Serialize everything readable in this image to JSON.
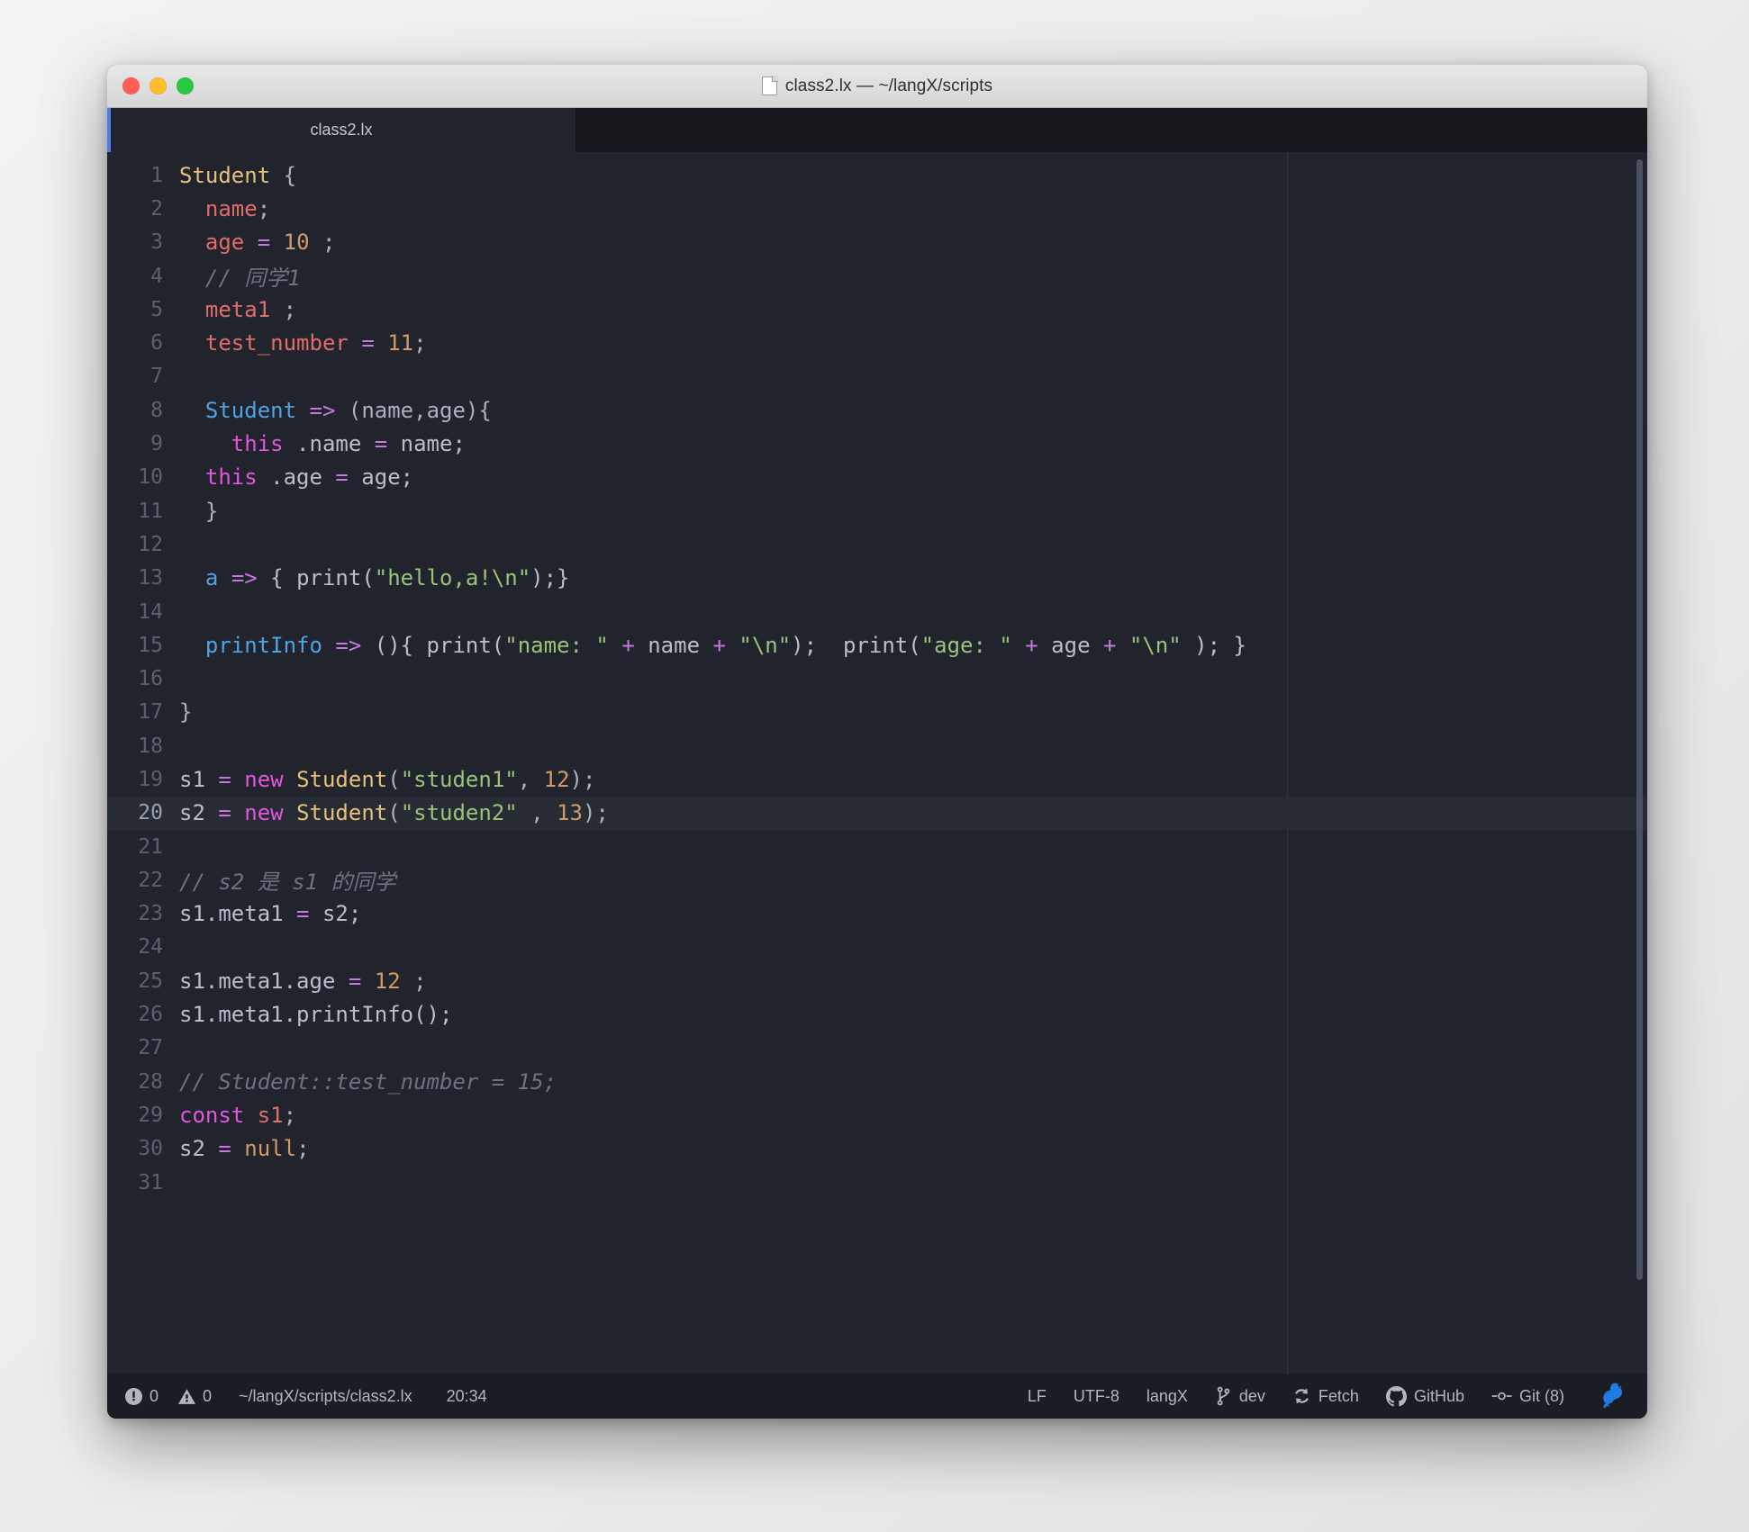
{
  "window": {
    "title": "class2.lx — ~/langX/scripts",
    "title_icon": "document-icon",
    "controls": {
      "close": "close",
      "minimize": "minimize",
      "zoom": "zoom"
    }
  },
  "tabs": [
    {
      "label": "class2.lx",
      "active": true
    }
  ],
  "editor": {
    "active_line": 20,
    "lines": [
      {
        "n": "1",
        "tokens": [
          {
            "t": "Student",
            "c": "t-class"
          },
          {
            "t": " {",
            "c": "t-punc"
          }
        ]
      },
      {
        "n": "2",
        "tokens": [
          {
            "t": "  ",
            "c": "t-plain"
          },
          {
            "t": "name",
            "c": "t-prop"
          },
          {
            "t": ";",
            "c": "t-punc"
          }
        ]
      },
      {
        "n": "3",
        "tokens": [
          {
            "t": "  ",
            "c": "t-plain"
          },
          {
            "t": "age",
            "c": "t-prop"
          },
          {
            "t": " ",
            "c": "t-plain"
          },
          {
            "t": "=",
            "c": "t-op"
          },
          {
            "t": " ",
            "c": "t-plain"
          },
          {
            "t": "10",
            "c": "t-num"
          },
          {
            "t": " ;",
            "c": "t-punc"
          }
        ]
      },
      {
        "n": "4",
        "tokens": [
          {
            "t": "  // 同学1",
            "c": "t-comment"
          }
        ]
      },
      {
        "n": "5",
        "tokens": [
          {
            "t": "  ",
            "c": "t-plain"
          },
          {
            "t": "meta1",
            "c": "t-prop"
          },
          {
            "t": " ;",
            "c": "t-punc"
          }
        ]
      },
      {
        "n": "6",
        "tokens": [
          {
            "t": "  ",
            "c": "t-plain"
          },
          {
            "t": "test_number",
            "c": "t-prop"
          },
          {
            "t": " ",
            "c": "t-plain"
          },
          {
            "t": "=",
            "c": "t-op"
          },
          {
            "t": " ",
            "c": "t-plain"
          },
          {
            "t": "11",
            "c": "t-num"
          },
          {
            "t": ";",
            "c": "t-punc"
          }
        ]
      },
      {
        "n": "7",
        "tokens": []
      },
      {
        "n": "8",
        "tokens": [
          {
            "t": "  ",
            "c": "t-plain"
          },
          {
            "t": "Student",
            "c": "t-fn"
          },
          {
            "t": " ",
            "c": "t-plain"
          },
          {
            "t": "=>",
            "c": "t-op"
          },
          {
            "t": " (name,age){",
            "c": "t-punc"
          }
        ]
      },
      {
        "n": "9",
        "tokens": [
          {
            "t": "    ",
            "c": "t-plain"
          },
          {
            "t": "this",
            "c": "t-kw"
          },
          {
            "t": " .name ",
            "c": "t-plain"
          },
          {
            "t": "=",
            "c": "t-op"
          },
          {
            "t": " name;",
            "c": "t-plain"
          }
        ]
      },
      {
        "n": "10",
        "tokens": [
          {
            "t": "  ",
            "c": "t-plain"
          },
          {
            "t": "this",
            "c": "t-kw"
          },
          {
            "t": " .age ",
            "c": "t-plain"
          },
          {
            "t": "=",
            "c": "t-op"
          },
          {
            "t": " age;",
            "c": "t-plain"
          }
        ]
      },
      {
        "n": "11",
        "tokens": [
          {
            "t": "  }",
            "c": "t-punc"
          }
        ]
      },
      {
        "n": "12",
        "tokens": []
      },
      {
        "n": "13",
        "tokens": [
          {
            "t": "  ",
            "c": "t-plain"
          },
          {
            "t": "a",
            "c": "t-fn"
          },
          {
            "t": " ",
            "c": "t-plain"
          },
          {
            "t": "=>",
            "c": "t-op"
          },
          {
            "t": " { print(",
            "c": "t-plain"
          },
          {
            "t": "\"hello,a!\\n\"",
            "c": "t-str"
          },
          {
            "t": ");}",
            "c": "t-plain"
          }
        ]
      },
      {
        "n": "14",
        "tokens": []
      },
      {
        "n": "15",
        "tokens": [
          {
            "t": "  ",
            "c": "t-plain"
          },
          {
            "t": "printInfo",
            "c": "t-fn"
          },
          {
            "t": " ",
            "c": "t-plain"
          },
          {
            "t": "=>",
            "c": "t-op"
          },
          {
            "t": " (){ print(",
            "c": "t-plain"
          },
          {
            "t": "\"name: \"",
            "c": "t-str"
          },
          {
            "t": " ",
            "c": "t-plain"
          },
          {
            "t": "+",
            "c": "t-op"
          },
          {
            "t": " name ",
            "c": "t-plain"
          },
          {
            "t": "+",
            "c": "t-op"
          },
          {
            "t": " ",
            "c": "t-plain"
          },
          {
            "t": "\"\\n\"",
            "c": "t-str"
          },
          {
            "t": ");  print(",
            "c": "t-plain"
          },
          {
            "t": "\"age: \"",
            "c": "t-str"
          },
          {
            "t": " ",
            "c": "t-plain"
          },
          {
            "t": "+",
            "c": "t-op"
          },
          {
            "t": " age ",
            "c": "t-plain"
          },
          {
            "t": "+",
            "c": "t-op"
          },
          {
            "t": " ",
            "c": "t-plain"
          },
          {
            "t": "\"\\n\"",
            "c": "t-str"
          },
          {
            "t": " ); }",
            "c": "t-plain"
          }
        ]
      },
      {
        "n": "16",
        "tokens": []
      },
      {
        "n": "17",
        "tokens": [
          {
            "t": "}",
            "c": "t-punc"
          }
        ]
      },
      {
        "n": "18",
        "tokens": []
      },
      {
        "n": "19",
        "tokens": [
          {
            "t": "s1 ",
            "c": "t-plain"
          },
          {
            "t": "=",
            "c": "t-op"
          },
          {
            "t": " ",
            "c": "t-plain"
          },
          {
            "t": "new",
            "c": "t-kw"
          },
          {
            "t": " ",
            "c": "t-plain"
          },
          {
            "t": "Student",
            "c": "t-class"
          },
          {
            "t": "(",
            "c": "t-punc"
          },
          {
            "t": "\"studen1\"",
            "c": "t-str"
          },
          {
            "t": ", ",
            "c": "t-punc"
          },
          {
            "t": "12",
            "c": "t-num"
          },
          {
            "t": ");",
            "c": "t-punc"
          }
        ]
      },
      {
        "n": "20",
        "tokens": [
          {
            "t": "s2 ",
            "c": "t-plain"
          },
          {
            "t": "=",
            "c": "t-op"
          },
          {
            "t": " ",
            "c": "t-plain"
          },
          {
            "t": "new",
            "c": "t-kw"
          },
          {
            "t": " ",
            "c": "t-plain"
          },
          {
            "t": "Student",
            "c": "t-class"
          },
          {
            "t": "(",
            "c": "t-punc"
          },
          {
            "t": "\"studen2\"",
            "c": "t-str"
          },
          {
            "t": " , ",
            "c": "t-punc"
          },
          {
            "t": "13",
            "c": "t-num"
          },
          {
            "t": ");",
            "c": "t-punc"
          }
        ]
      },
      {
        "n": "21",
        "tokens": []
      },
      {
        "n": "22",
        "tokens": [
          {
            "t": "// s2 是 s1 的同学",
            "c": "t-comment"
          }
        ]
      },
      {
        "n": "23",
        "tokens": [
          {
            "t": "s1.meta1 ",
            "c": "t-plain"
          },
          {
            "t": "=",
            "c": "t-op"
          },
          {
            "t": " s2;",
            "c": "t-plain"
          }
        ]
      },
      {
        "n": "24",
        "tokens": []
      },
      {
        "n": "25",
        "tokens": [
          {
            "t": "s1.meta1.age ",
            "c": "t-plain"
          },
          {
            "t": "=",
            "c": "t-op"
          },
          {
            "t": " ",
            "c": "t-plain"
          },
          {
            "t": "12",
            "c": "t-num"
          },
          {
            "t": " ;",
            "c": "t-punc"
          }
        ]
      },
      {
        "n": "26",
        "tokens": [
          {
            "t": "s1.meta1.printInfo();",
            "c": "t-plain"
          }
        ]
      },
      {
        "n": "27",
        "tokens": []
      },
      {
        "n": "28",
        "tokens": [
          {
            "t": "// Student::test_number = 15;",
            "c": "t-comment"
          }
        ]
      },
      {
        "n": "29",
        "tokens": [
          {
            "t": "const",
            "c": "t-kw"
          },
          {
            "t": " ",
            "c": "t-plain"
          },
          {
            "t": "s1",
            "c": "t-prop"
          },
          {
            "t": ";",
            "c": "t-punc"
          }
        ]
      },
      {
        "n": "30",
        "tokens": [
          {
            "t": "s2 ",
            "c": "t-plain"
          },
          {
            "t": "=",
            "c": "t-op"
          },
          {
            "t": " ",
            "c": "t-plain"
          },
          {
            "t": "null",
            "c": "t-num"
          },
          {
            "t": ";",
            "c": "t-punc"
          }
        ]
      },
      {
        "n": "31",
        "tokens": []
      }
    ]
  },
  "statusbar": {
    "error_icon": "error-icon",
    "error_count": "0",
    "warning_icon": "warning-icon",
    "warning_count": "0",
    "file_path": "~/langX/scripts/class2.lx",
    "cursor_position": "20:34",
    "line_ending": "LF",
    "encoding": "UTF-8",
    "grammar": "langX",
    "branch_icon": "git-branch-icon",
    "branch": "dev",
    "fetch_icon": "refresh-icon",
    "fetch": "Fetch",
    "github_icon": "github-icon",
    "github": "GitHub",
    "git_icon": "git-commit-icon",
    "git": "Git (8)",
    "app_icon": "squirrel-icon"
  },
  "colors": {
    "accent": "#4f7fe8",
    "editor_bg": "#21242c",
    "statusbar_bg": "#1a1d23",
    "string": "#98c379",
    "keyword": "#e355e0",
    "number": "#d19a66",
    "class": "#e5c07b",
    "function": "#4fa3e3",
    "property": "#e06c6c",
    "operator": "#c678dd",
    "comment": "#6b7280",
    "squirrel": "#1f7ce0"
  }
}
